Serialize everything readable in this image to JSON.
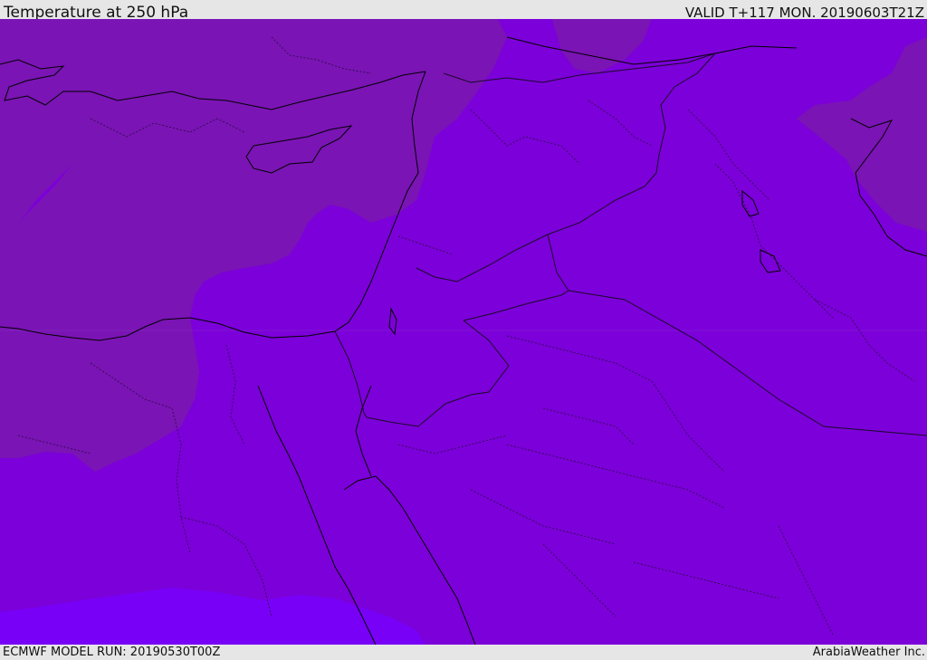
{
  "header": {
    "title": "Temperature at 250 hPa",
    "valid": "VALID T+117 MON. 20190603T21Z"
  },
  "footer": {
    "model_run": "ECMWF MODEL RUN: 20190530T00Z",
    "credit": "ArabiaWeather Inc."
  },
  "map": {
    "colors": {
      "background_field": "#7c00d9",
      "cooler_field": "#7a14b4",
      "warmer_field": "#7800f6",
      "coast": "#000000",
      "border": "#1a0a2a"
    }
  }
}
